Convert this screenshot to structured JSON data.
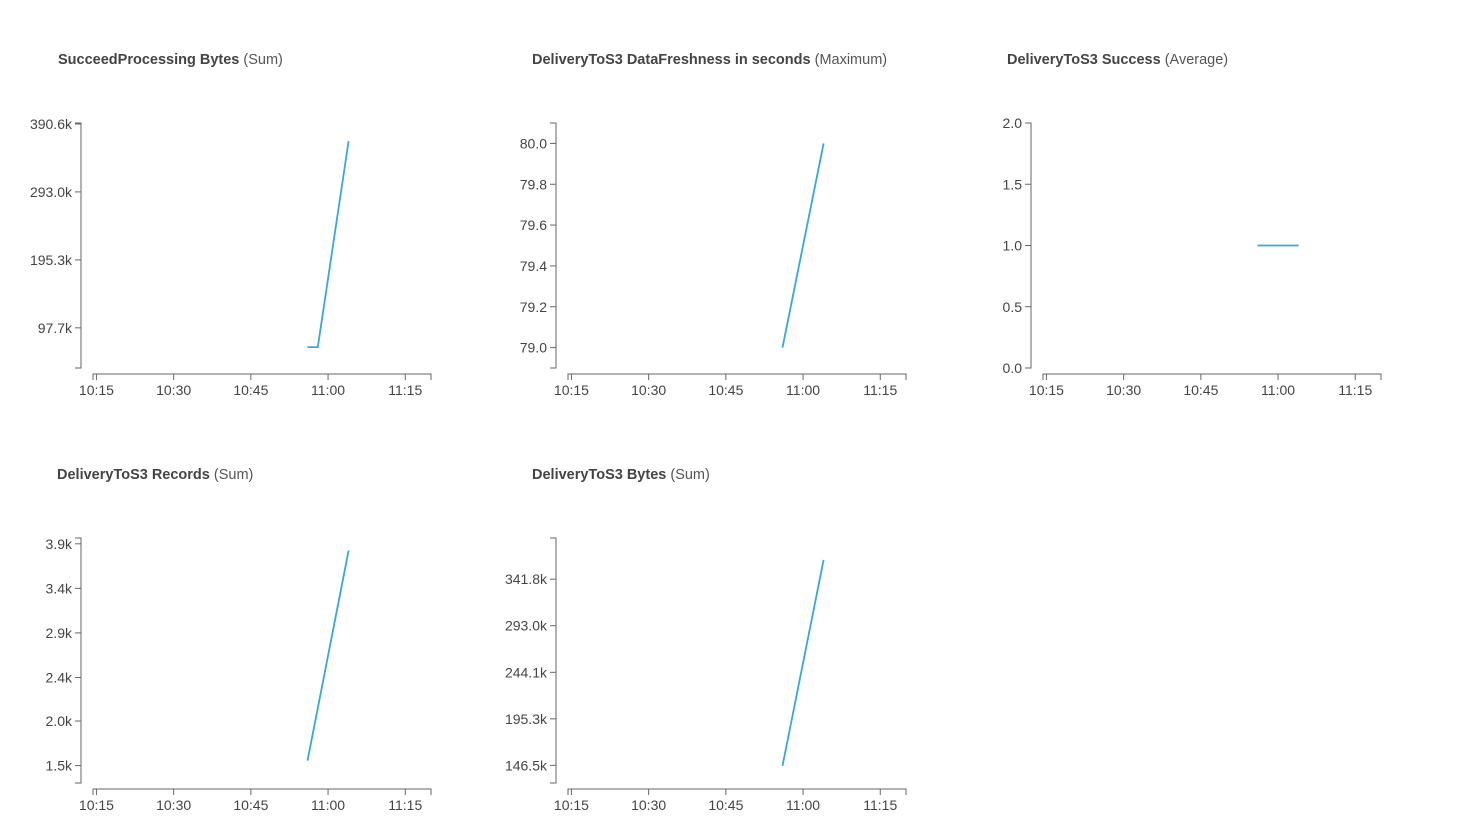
{
  "chart_data": [
    {
      "type": "line",
      "title_metric": "SucceedProcessing Bytes",
      "title_stat": "(Sum)",
      "x_ticks": [
        "10:15",
        "10:30",
        "10:45",
        "11:00",
        "11:15"
      ],
      "xlim": [
        "10:12",
        "11:20"
      ],
      "y_ticks": [
        "97.7k",
        "195.3k",
        "293.0k",
        "390.6k"
      ],
      "y_tick_values": [
        97700,
        195300,
        293000,
        390600
      ],
      "ylim": [
        40000,
        392000
      ],
      "series": [
        {
          "color": "#38a8d6",
          "points": [
            [
              "10:56",
              70000
            ],
            [
              "10:58",
              70000
            ],
            [
              "11:04",
              366000
            ]
          ]
        }
      ]
    },
    {
      "type": "line",
      "title_metric": "DeliveryToS3 DataFreshness in seconds",
      "title_stat": "(Maximum)",
      "x_ticks": [
        "10:15",
        "10:30",
        "10:45",
        "11:00",
        "11:15"
      ],
      "xlim": [
        "10:12",
        "11:20"
      ],
      "y_ticks": [
        "79.0",
        "79.2",
        "79.4",
        "79.6",
        "79.8",
        "80.0"
      ],
      "y_tick_values": [
        79.0,
        79.2,
        79.4,
        79.6,
        79.8,
        80.0
      ],
      "ylim": [
        78.9,
        80.1
      ],
      "series": [
        {
          "color": "#38a8d6",
          "points": [
            [
              "10:56",
              79.0
            ],
            [
              "11:04",
              80.0
            ]
          ]
        }
      ]
    },
    {
      "type": "line",
      "title_metric": "DeliveryToS3 Success",
      "title_stat": "(Average)",
      "x_ticks": [
        "10:15",
        "10:30",
        "10:45",
        "11:00",
        "11:15"
      ],
      "xlim": [
        "10:12",
        "11:20"
      ],
      "y_ticks": [
        "0.0",
        "0.5",
        "1.0",
        "1.5",
        "2.0"
      ],
      "y_tick_values": [
        0.0,
        0.5,
        1.0,
        1.5,
        2.0
      ],
      "ylim": [
        0.0,
        2.0
      ],
      "series": [
        {
          "color": "#38a8d6",
          "points": [
            [
              "10:56",
              1.0
            ],
            [
              "11:04",
              1.0
            ]
          ]
        }
      ]
    },
    {
      "type": "line",
      "title_metric": "DeliveryToS3 Records",
      "title_stat": "(Sum)",
      "x_ticks": [
        "10:15",
        "10:30",
        "10:45",
        "11:00",
        "11:15"
      ],
      "xlim": [
        "10:12",
        "11:20"
      ],
      "y_ticks": [
        "1.5k",
        "2.0k",
        "2.4k",
        "2.9k",
        "3.4k",
        "3.9k"
      ],
      "y_tick_values": [
        1530,
        1990,
        2440,
        2900,
        3360,
        3820
      ],
      "ylim": [
        1350,
        3880
      ],
      "series": [
        {
          "color": "#38a8d6",
          "points": [
            [
              "10:56",
              1580
            ],
            [
              "11:04",
              3750
            ]
          ]
        }
      ]
    },
    {
      "type": "line",
      "title_metric": "DeliveryToS3 Bytes",
      "title_stat": "(Sum)",
      "x_ticks": [
        "10:15",
        "10:30",
        "10:45",
        "11:00",
        "11:15"
      ],
      "xlim": [
        "10:12",
        "11:20"
      ],
      "y_ticks": [
        "146.5k",
        "195.3k",
        "244.1k",
        "293.0k",
        "341.8k"
      ],
      "y_tick_values": [
        146500,
        195300,
        244100,
        293000,
        341800
      ],
      "ylim": [
        128000,
        385000
      ],
      "series": [
        {
          "color": "#38a8d6",
          "points": [
            [
              "10:56",
              146000
            ],
            [
              "11:04",
              362000
            ]
          ]
        }
      ]
    }
  ]
}
